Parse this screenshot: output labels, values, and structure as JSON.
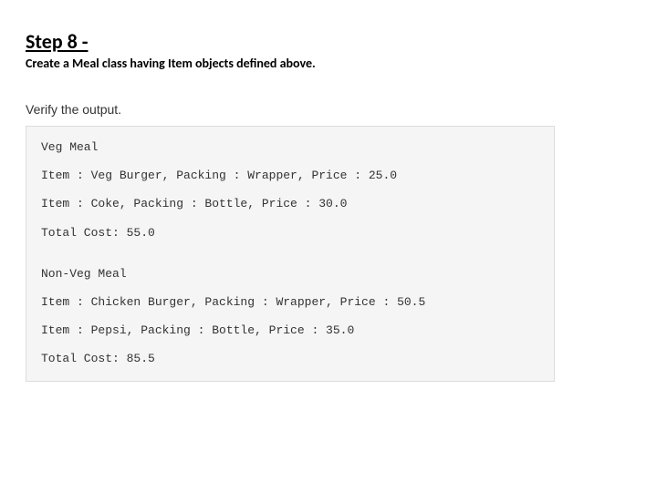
{
  "heading": {
    "title": "Step 8 -",
    "description": "Create a Meal class having Item  objects defined above."
  },
  "verify_label": "Verify the output.",
  "output": {
    "section1": {
      "title": "Veg Meal",
      "line1": "Item : Veg Burger, Packing : Wrapper, Price : 25.0",
      "line2": "Item : Coke, Packing : Bottle, Price : 30.0",
      "total": "Total Cost: 55.0"
    },
    "section2": {
      "title": "Non-Veg Meal",
      "line1": "Item : Chicken Burger, Packing : Wrapper, Price : 50.5",
      "line2": "Item : Pepsi, Packing : Bottle, Price : 35.0",
      "total": "Total Cost: 85.5"
    }
  }
}
